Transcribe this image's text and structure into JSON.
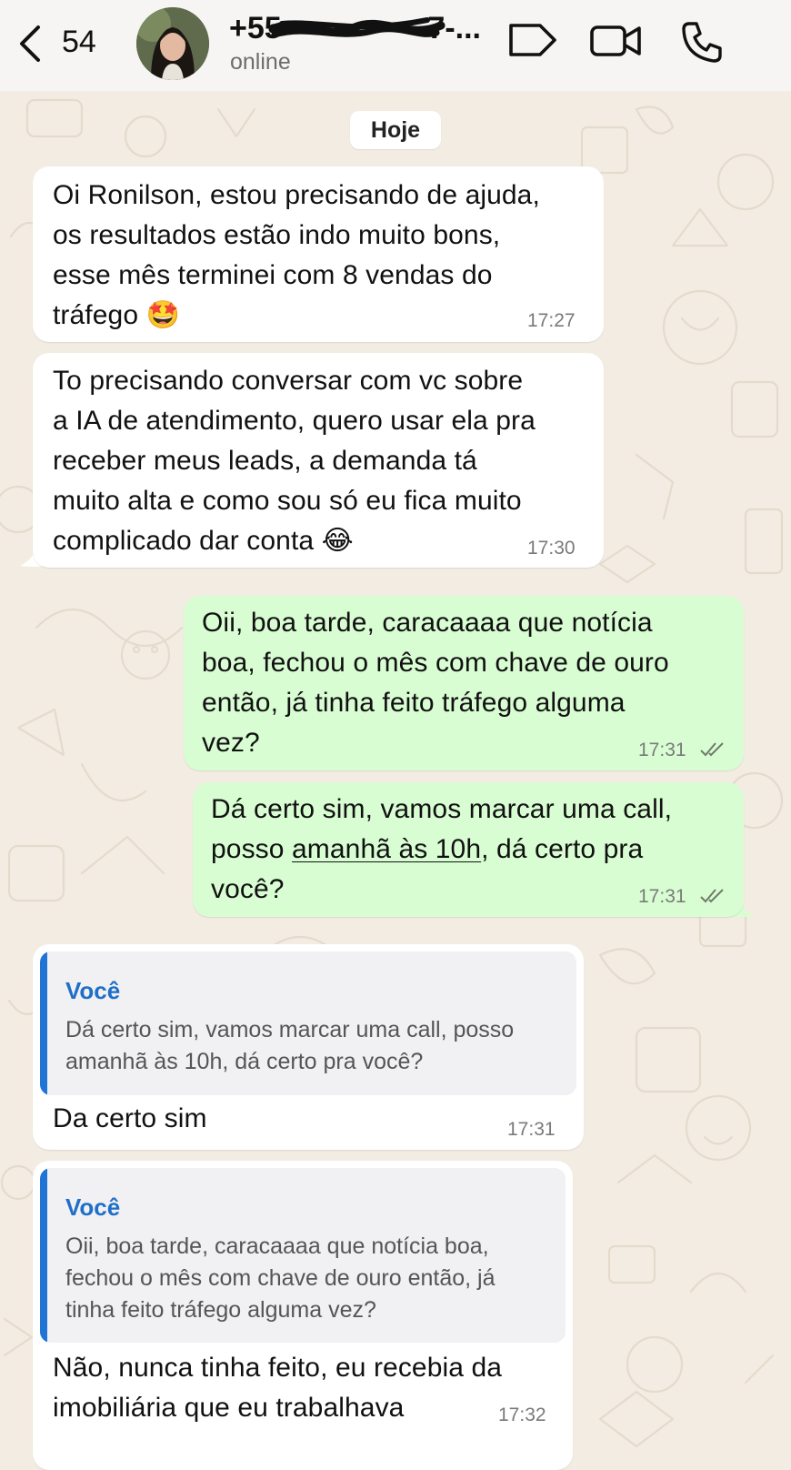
{
  "header": {
    "unread_count": "54",
    "contact_name": "+55 ",
    "contact_name_tail": "7-...",
    "status": "online",
    "icons": [
      "back-chevron-icon",
      "tag-icon",
      "video-call-icon",
      "phone-call-icon"
    ]
  },
  "date_separator": "Hoje",
  "messages": [
    {
      "direction": "in",
      "lines": [
        "Oi Ronilson, estou precisando de ajuda,",
        "os resultados estão indo muito bons,",
        "esse mês terminei com 8 vendas do",
        "tráfego"
      ],
      "emoji": "🤩",
      "time": "17:27"
    },
    {
      "direction": "in",
      "lines": [
        "To precisando conversar com vc sobre",
        "a IA de atendimento, quero usar ela pra",
        "receber meus leads, a demanda tá",
        "muito alta e como sou só eu fica muito",
        "complicado dar conta"
      ],
      "emoji": "😂",
      "time": "17:30"
    },
    {
      "direction": "out",
      "lines": [
        "Oii, boa tarde, caracaaaa que notícia",
        "boa, fechou o mês com chave de ouro",
        "então, já tinha feito tráfego alguma",
        "vez?"
      ],
      "time": "17:31"
    },
    {
      "direction": "out",
      "line1": "Dá certo sim, vamos marcar uma call,",
      "line2_pre": "posso ",
      "line2_link": "amanhã às 10h",
      "line2_post": ", dá certo pra",
      "line3": "você?",
      "time": "17:31"
    },
    {
      "direction": "in",
      "quote_author": "Você",
      "quote_lines": [
        "Dá certo sim, vamos marcar uma call, posso",
        "amanhã às 10h, dá certo pra você?"
      ],
      "text": "Da certo sim",
      "time": "17:31"
    },
    {
      "direction": "in",
      "quote_author": "Você",
      "quote_lines": [
        "Oii, boa tarde, caracaaaa que notícia boa,",
        "fechou o mês com chave de ouro então, já",
        "tinha feito tráfego alguma vez?"
      ],
      "lines": [
        "Não, nunca tinha feito, eu recebia da",
        "imobiliária que eu trabalhava"
      ],
      "time": "17:32"
    }
  ],
  "colors": {
    "background": "#f3ece2",
    "incoming": "#ffffff",
    "outgoing": "#d9fdd3",
    "quote_accent": "#1f74d6"
  }
}
